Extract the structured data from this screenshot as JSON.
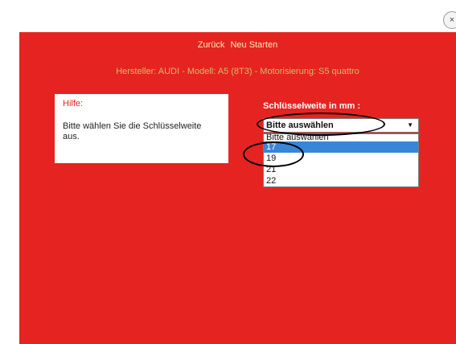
{
  "window": {
    "close_label": "×"
  },
  "nav": {
    "back_label": "Zurück",
    "restart_label": "Neu Starten"
  },
  "subtitle": "Hersteller: AUDI - Modell: A5 (8T3) - Motorisierung: S5 quattro",
  "help": {
    "title": "Hilfe:",
    "text": "Bitte wählen Sie die Schlüsselweite aus."
  },
  "select": {
    "label": "Schlüsselweite in mm :",
    "current_value": "Bitte auswählen",
    "arrow_icon": "▼",
    "options": [
      "Bitte auswählen",
      "17",
      "19",
      "21",
      "22"
    ],
    "selected_option": "17"
  },
  "colors": {
    "panel_background": "#e52421",
    "selected_option": "#3a86d6",
    "annotation_ellipse": "#000000"
  }
}
